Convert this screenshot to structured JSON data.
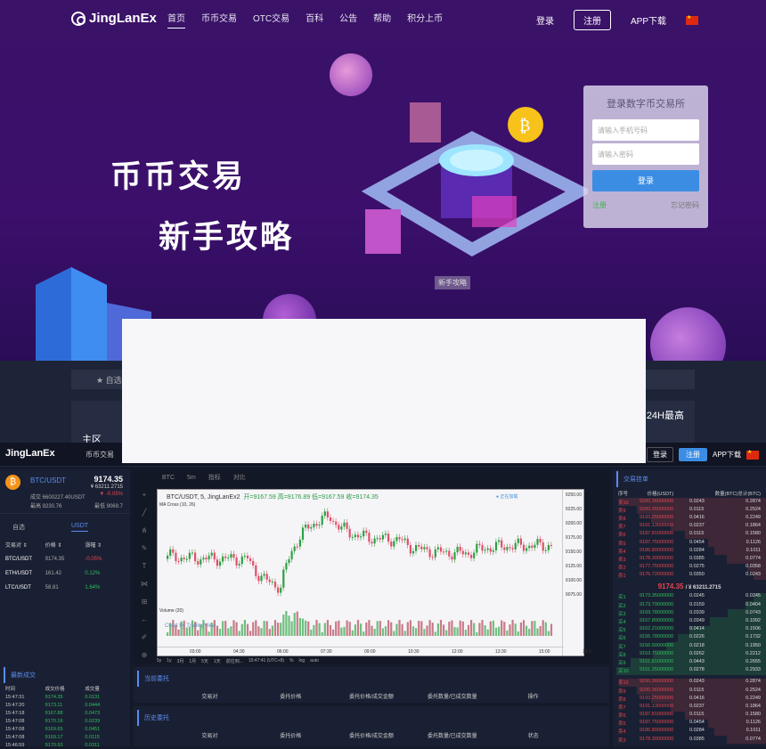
{
  "brand": "JingLanEx",
  "nav": {
    "links": [
      "首页",
      "币币交易",
      "OTC交易",
      "百科",
      "公告",
      "帮助",
      "积分上币"
    ],
    "login": "登录",
    "register": "注册",
    "app": "APP下载"
  },
  "hero": {
    "line1": "币币交易",
    "line2": "新手攻略",
    "guide_tag": "新手攻略"
  },
  "login_box": {
    "title": "登录数字币交易所",
    "phone_placeholder": "请输入手机号码",
    "password_placeholder": "请输入密码",
    "login_btn": "登录",
    "register_link": "注册",
    "forgot_link": "忘记密码"
  },
  "mid": {
    "fav_label": "自选",
    "zone_label": "主区",
    "high_label": "24H最高"
  },
  "exchange": {
    "nav_link": "币币交易",
    "login": "登录",
    "register": "注册",
    "app": "APP下载",
    "ticker": {
      "pair": "BTC/USDT",
      "price": "9174.35",
      "cny": "¥ 63211.2715",
      "change": "▼ -0.05%",
      "volume": "成交 6600227.40USDT",
      "high": "最高 9230.76",
      "low": "最低 9069.7"
    },
    "market_tabs": [
      "自选",
      "USDT"
    ],
    "market_head": [
      "交易对 ⇕",
      "价格 ⇕",
      "涨幅 ⇕"
    ],
    "markets": [
      {
        "pair": "BTC/USDT",
        "price": "9174.35",
        "change": "-0.05%",
        "dir": "dn"
      },
      {
        "pair": "ETH/USDT",
        "price": "161.42",
        "change": "0.12%",
        "dir": "up"
      },
      {
        "pair": "LTC/USDT",
        "price": "58.81",
        "change": "1.64%",
        "dir": "up"
      }
    ],
    "trades_title": "最新成交",
    "trades_head": [
      "时间",
      "成交价格",
      "成交量"
    ],
    "trades": [
      [
        "15:47:31",
        "9174.35",
        "0.0131"
      ],
      [
        "15:47:20",
        "9173.11",
        "0.0444"
      ],
      [
        "15:47:18",
        "9167.88",
        "0.0473"
      ],
      [
        "15:47:08",
        "9170.16",
        "0.0239"
      ],
      [
        "15:47:08",
        "9169.65",
        "0.0451"
      ],
      [
        "15:47:08",
        "9169.17",
        "0.0115"
      ],
      [
        "15:46:59",
        "9170.93",
        "0.0311"
      ]
    ],
    "chart_toolbar": [
      "BTC",
      "5m",
      "指标",
      "对比"
    ],
    "chart_title": "BTC/USDT, 5, JingLanEx2",
    "chart_ohlc": "开=9167.59  高=9176.89  低=9167.59  收=9174.35",
    "chart_ma": "MA Cross (10, 26)",
    "chart_volume": "Volume (20)",
    "chart_live": "● 正在加载",
    "chart_watermark": "Chart by TradingView",
    "chart_bottom": [
      "5y",
      "1y",
      "3月",
      "1月",
      "5天",
      "1天",
      "前往到...",
      "15:47:41 (UTC+8)",
      "%",
      "log",
      "auto"
    ],
    "current_orders": "当前委托",
    "history_orders": "历史委托",
    "orders_head": [
      "交易对",
      "委托价格",
      "委托价格/成交金额",
      "委托数量/已成交数量",
      "操作"
    ],
    "history_head": [
      "交易对",
      "委托价格",
      "委托价格/成交金额",
      "委托数量/已成交数量",
      "状态"
    ],
    "book_title": "交易挂单",
    "book_head": [
      "序号",
      "价格(USDT)",
      "数量(BTC)",
      "总计(BTC)"
    ],
    "asks": [
      [
        "卖10",
        "9200.36000000",
        "0.0243",
        "0.2874"
      ],
      [
        "卖9",
        "9200.36000000",
        "0.0115",
        "0.2524"
      ],
      [
        "卖8",
        "9193.25000000",
        "0.0416",
        "0.2249"
      ],
      [
        "卖7",
        "9191.13000000",
        "0.0237",
        "0.1864"
      ],
      [
        "卖6",
        "9187.81000000",
        "0.0115",
        "0.1580"
      ],
      [
        "卖5",
        "9187.75000000",
        "0.0454",
        "0.1126"
      ],
      [
        "卖4",
        "9186.80000000",
        "0.0284",
        "0.1011"
      ],
      [
        "卖3",
        "9178.30000000",
        "0.0385",
        "0.0774"
      ],
      [
        "卖2",
        "9177.75000000",
        "0.0275",
        "0.0358"
      ],
      [
        "卖1",
        "9176.72000000",
        "0.0350",
        "0.0243"
      ]
    ],
    "book_price": "9174.35",
    "book_cny": "/ ¥ 63211.2715",
    "bids": [
      [
        "买1",
        "9173.35000000",
        "0.0245",
        "0.0245"
      ],
      [
        "买2",
        "9173.79000000",
        "0.0159",
        "0.0404"
      ],
      [
        "买3",
        "9169.78000000",
        "0.0339",
        "0.0743"
      ],
      [
        "买4",
        "9167.80000000",
        "0.0349",
        "0.1092"
      ],
      [
        "买5",
        "9162.21000000",
        "0.0414",
        "0.1506"
      ],
      [
        "买6",
        "9156.78000000",
        "0.0226",
        "0.1732"
      ],
      [
        "买7",
        "9156.50000000",
        "0.0218",
        "0.1950"
      ],
      [
        "买8",
        "9153.71000000",
        "0.0262",
        "0.2212"
      ],
      [
        "买9",
        "9151.81000000",
        "0.0443",
        "0.2655"
      ],
      [
        "买10",
        "9151.25000000",
        "0.0278",
        "0.2933"
      ]
    ],
    "asks2": [
      [
        "卖10",
        "9200.36000000",
        "0.0243",
        "0.2874"
      ],
      [
        "卖9",
        "9200.36000000",
        "0.0115",
        "0.2524"
      ],
      [
        "卖8",
        "9193.25000000",
        "0.0416",
        "0.2249"
      ],
      [
        "卖7",
        "9191.13000000",
        "0.0237",
        "0.1864"
      ],
      [
        "卖6",
        "9187.81000000",
        "0.0115",
        "0.1580"
      ],
      [
        "卖5",
        "9187.75000000",
        "0.0454",
        "0.1126"
      ],
      [
        "卖4",
        "9186.80000000",
        "0.0284",
        "0.1011"
      ],
      [
        "卖3",
        "9178.30000000",
        "0.0385",
        "0.0774"
      ]
    ],
    "y_ticks": [
      "9250.00",
      "9225.00",
      "9200.00",
      "9175.00",
      "9150.00",
      "9125.00",
      "9100.00",
      "9075.00"
    ],
    "x_ticks": [
      "03:00",
      "04:30",
      "06:00",
      "07:30",
      "09:00",
      "10:30",
      "12:00",
      "13:30",
      "15:00",
      "16:0"
    ]
  },
  "colors": {
    "up": "#2ec05a",
    "down": "#e2464f",
    "accent": "#3b8de3"
  }
}
